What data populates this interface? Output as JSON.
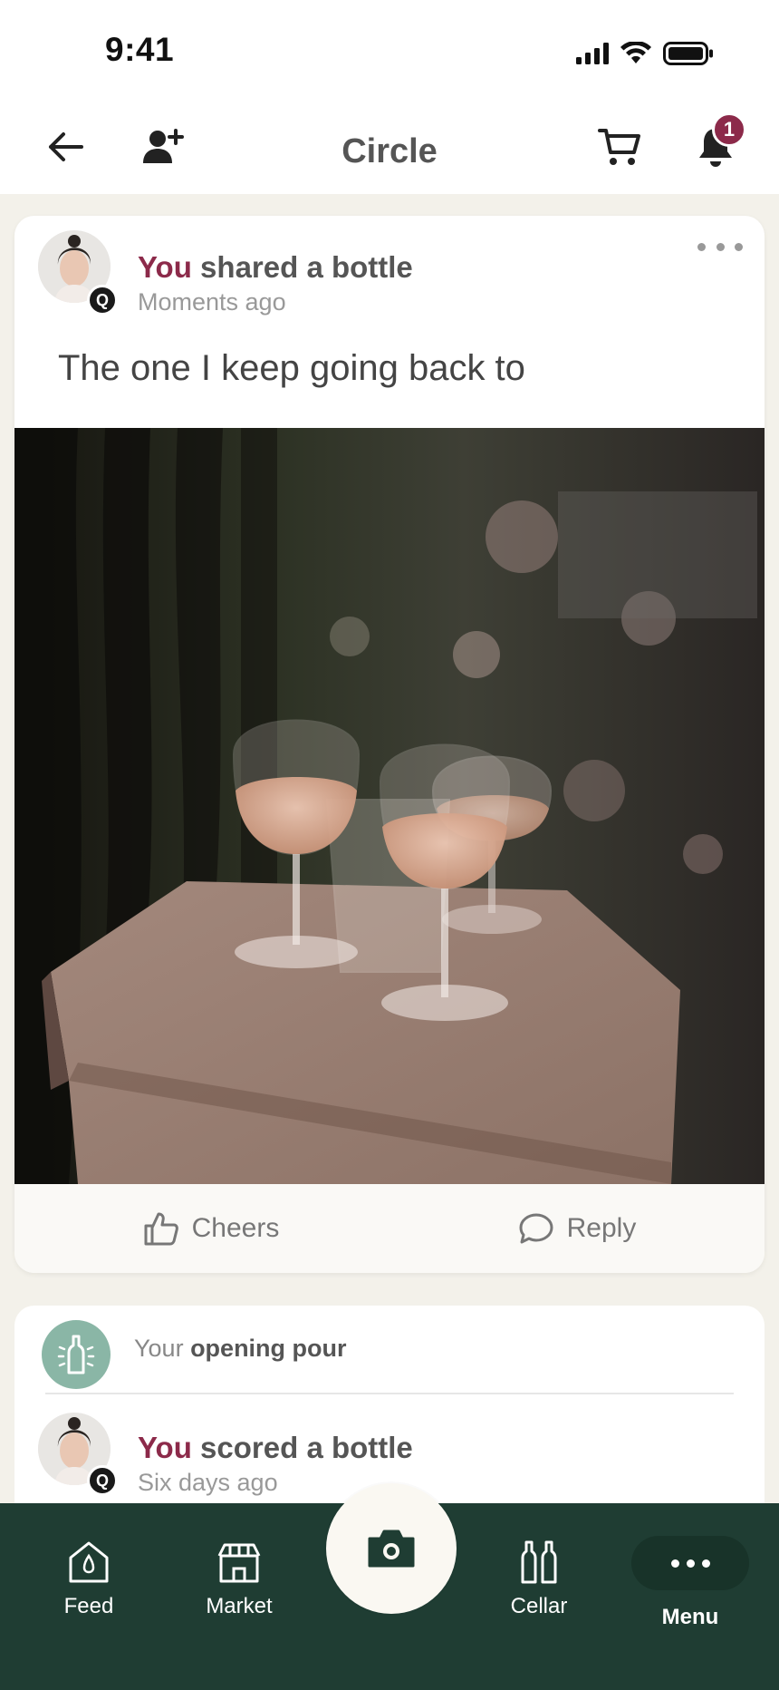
{
  "status_bar": {
    "time": "9:41"
  },
  "header": {
    "title": "Circle",
    "notification_count": "1",
    "icons": [
      "back-arrow-icon",
      "add-user-icon",
      "cart-icon",
      "bell-icon"
    ]
  },
  "post": {
    "author": "You",
    "action": " shared a bottle",
    "time": "Moments ago",
    "badge": "Q",
    "text": "The one I keep going back to",
    "photo_alt": "Three glasses of rosé wine on a hexagonal wooden table",
    "actions": {
      "cheers": "Cheers",
      "reply": "Reply"
    }
  },
  "card2": {
    "pour_prefix": "Your ",
    "pour_bold": "opening pour",
    "author": "You",
    "action": " scored a bottle",
    "time": "Six days ago",
    "badge": "Q"
  },
  "nav": {
    "items": [
      {
        "label": "Feed",
        "icon": "feed-icon"
      },
      {
        "label": "Market",
        "icon": "market-icon"
      },
      {
        "label": "Cellar",
        "icon": "cellar-icon"
      },
      {
        "label": "Menu",
        "icon": "more-icon"
      }
    ],
    "camera_icon": "camera-icon"
  },
  "colors": {
    "accent": "#8c2a4a",
    "nav_bg": "#1f3d33",
    "page_bg": "#f3f1ea",
    "pour_badge": "#8ab6a6"
  }
}
